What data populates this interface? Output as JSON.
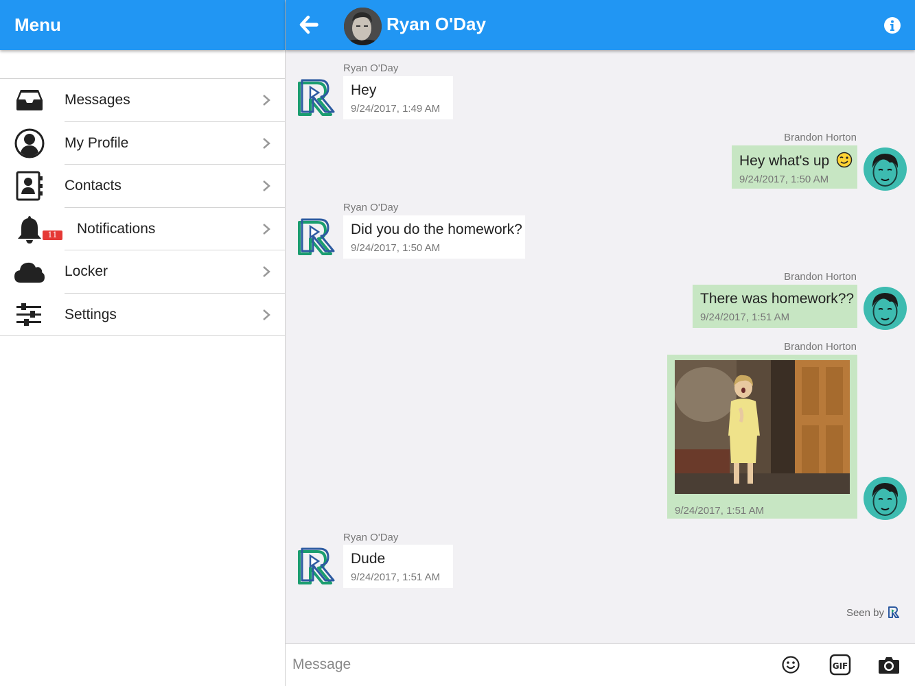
{
  "sidebar": {
    "title": "Menu",
    "items": [
      {
        "label": "Messages",
        "icon": "inbox-icon"
      },
      {
        "label": "My Profile",
        "icon": "user-circle-icon"
      },
      {
        "label": "Contacts",
        "icon": "address-book-icon"
      },
      {
        "label": "Notifications",
        "icon": "bell-icon",
        "badge": "11"
      },
      {
        "label": "Locker",
        "icon": "cloud-icon"
      },
      {
        "label": "Settings",
        "icon": "sliders-icon"
      }
    ]
  },
  "chat": {
    "contact_name": "Ryan O'Day",
    "messages": [
      {
        "sender": "Ryan O'Day",
        "direction": "incoming",
        "text": "Hey",
        "time": "9/24/2017, 1:49 AM"
      },
      {
        "sender": "Brandon Horton",
        "direction": "outgoing",
        "text": "Hey what's up",
        "emoji": "wink-emoji-icon",
        "time": "9/24/2017, 1:50 AM"
      },
      {
        "sender": "Ryan O'Day",
        "direction": "incoming",
        "text": "Did you do the homework?",
        "time": "9/24/2017, 1:50 AM"
      },
      {
        "sender": "Brandon Horton",
        "direction": "outgoing",
        "text": "There was homework??",
        "time": "9/24/2017, 1:51 AM"
      },
      {
        "sender": "Brandon Horton",
        "direction": "outgoing",
        "type": "gif",
        "time": "9/24/2017, 1:51 AM"
      },
      {
        "sender": "Ryan O'Day",
        "direction": "incoming",
        "text": "Dude",
        "time": "9/24/2017, 1:51 AM"
      }
    ],
    "seen_label": "Seen by",
    "input_placeholder": "Message"
  },
  "colors": {
    "primary": "#2196f3",
    "outgoing_bubble": "#c7e6c3",
    "incoming_bubble": "#ffffff",
    "chat_background": "#f2f1f4",
    "badge": "#e53935",
    "avatar_teal": "#3dbbb0"
  }
}
